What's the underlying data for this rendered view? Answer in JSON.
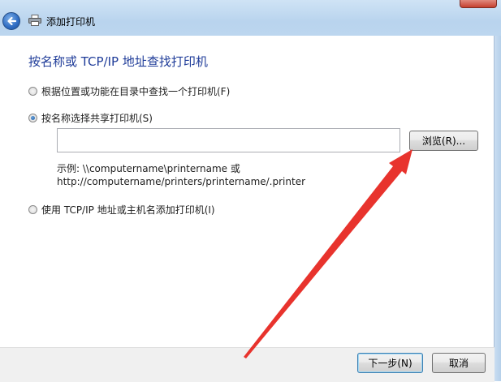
{
  "window": {
    "title": "添加打印机"
  },
  "main": {
    "heading": "按名称或 TCP/IP 地址查找打印机",
    "options": [
      {
        "label": "根据位置或功能在目录中查找一个打印机(F)",
        "checked": false
      },
      {
        "label": "按名称选择共享打印机(S)",
        "checked": true
      },
      {
        "label": "使用 TCP/IP 地址或主机名添加打印机(I)",
        "checked": false
      }
    ],
    "printer_path": {
      "value": "",
      "placeholder": ""
    },
    "browse_button": "浏览(R)...",
    "example_line1": "示例: \\\\computername\\printername 或",
    "example_line2": "http://computername/printers/printername/.printer"
  },
  "footer": {
    "next_button": "下一步(N)",
    "cancel_button": "取消"
  },
  "icons": {
    "back": "back-arrow-icon",
    "printer": "printer-icon",
    "annotation": "red-arrow-annotation"
  },
  "colors": {
    "heading": "#1f3c99",
    "annotation_arrow": "#e8332d",
    "title_glass": "#b9d4ee"
  }
}
